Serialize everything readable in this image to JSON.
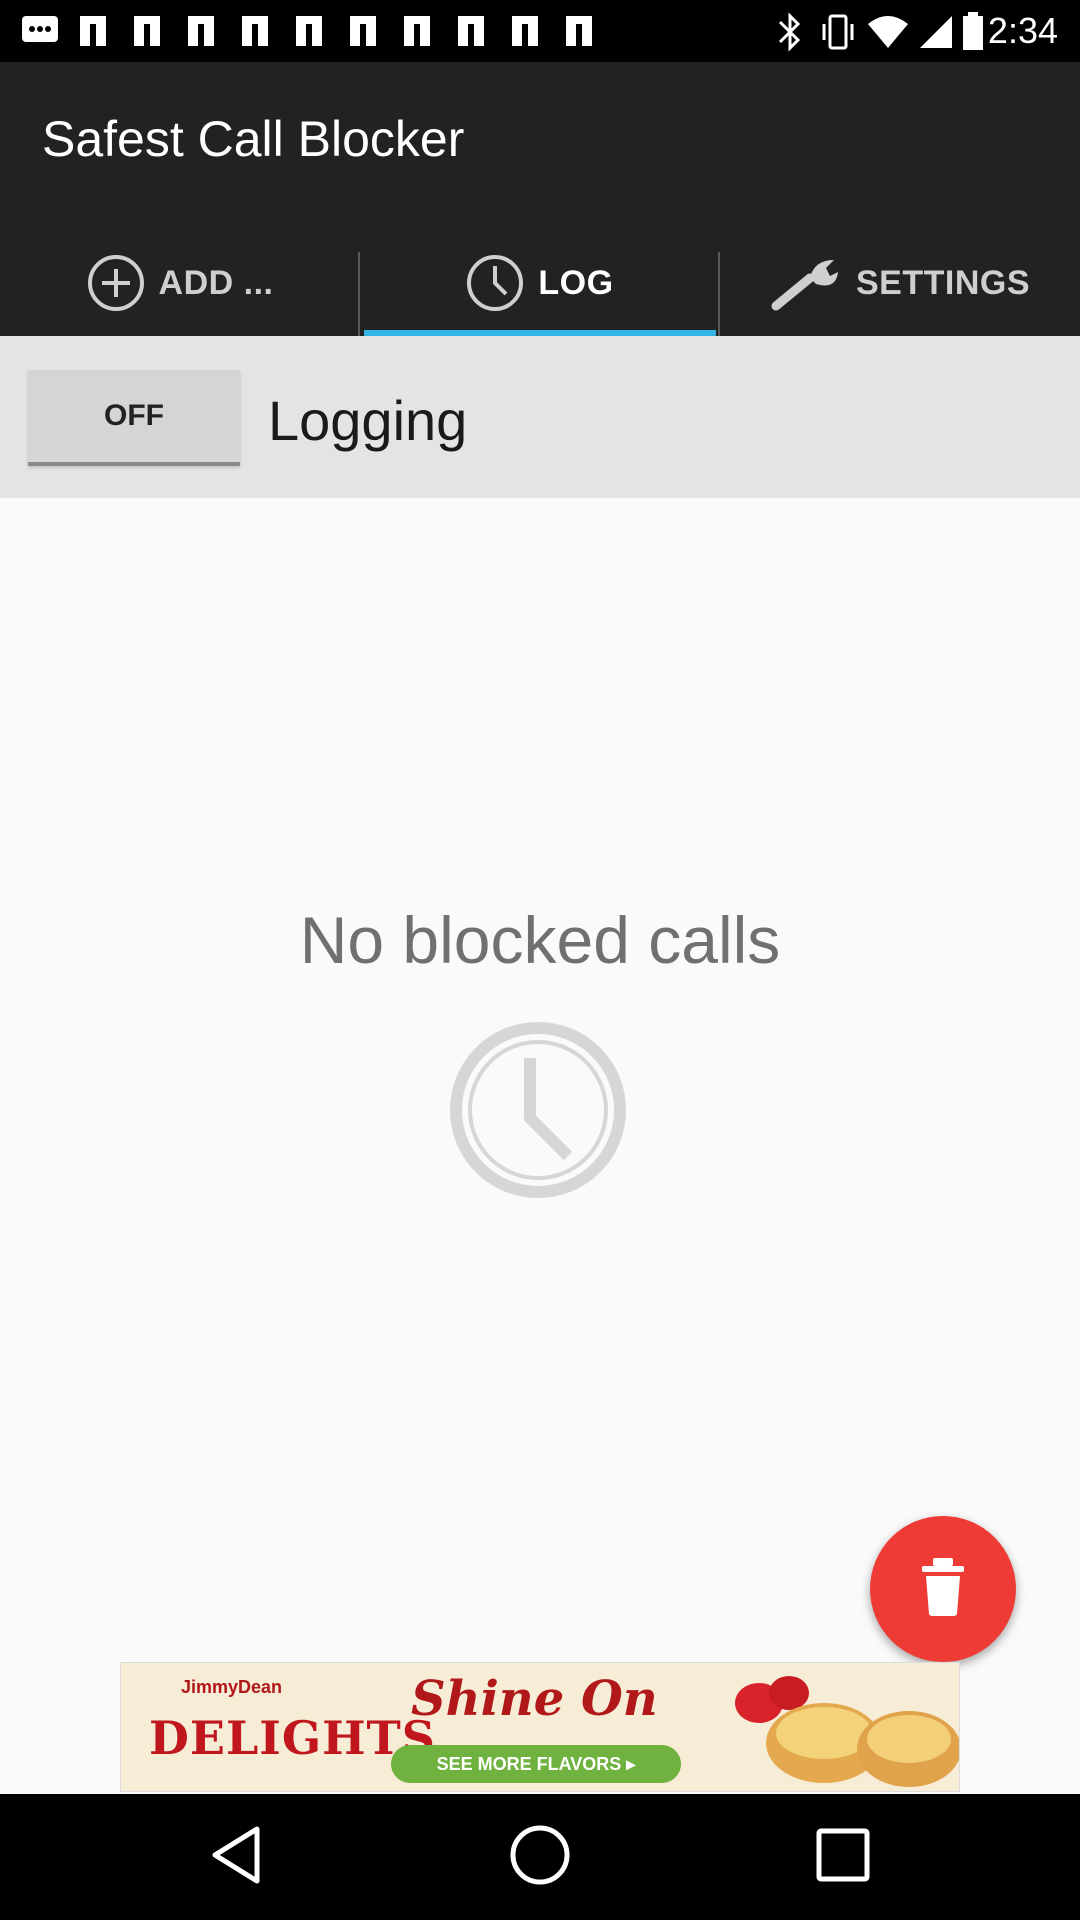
{
  "status_bar": {
    "time": "2:34",
    "notification_icons": [
      "message-icon",
      "notification-icon",
      "notification-icon",
      "notification-icon",
      "notification-icon",
      "notification-icon",
      "notification-icon",
      "notification-icon",
      "notification-icon",
      "notification-icon"
    ],
    "system_icons": [
      "bluetooth-icon",
      "vibrate-icon",
      "wifi-icon",
      "signal-icon",
      "battery-icon"
    ]
  },
  "app_bar": {
    "title": "Safest Call Blocker"
  },
  "tabs": [
    {
      "label": "ADD ...",
      "icon": "add-circle-icon",
      "active": false
    },
    {
      "label": "LOG",
      "icon": "clock-icon",
      "active": true
    },
    {
      "label": "SETTINGS",
      "icon": "wrench-icon",
      "active": false
    }
  ],
  "logging": {
    "toggle_state": "OFF",
    "label": "Logging"
  },
  "empty_state": {
    "message": "No blocked calls",
    "icon": "clock-icon"
  },
  "fab": {
    "icon": "trash-icon",
    "color": "#ee3b35"
  },
  "ad": {
    "brand_top": "JimmyDean",
    "brand": "DELIGHTS",
    "headline": "Shine On",
    "cta": "SEE MORE FLAVORS ▸"
  },
  "nav_bar": {
    "buttons": [
      "back-icon",
      "home-icon",
      "recents-icon"
    ]
  },
  "colors": {
    "app_bar": "#222222",
    "tab_indicator": "#33b5e5",
    "fab": "#ee3b35"
  }
}
